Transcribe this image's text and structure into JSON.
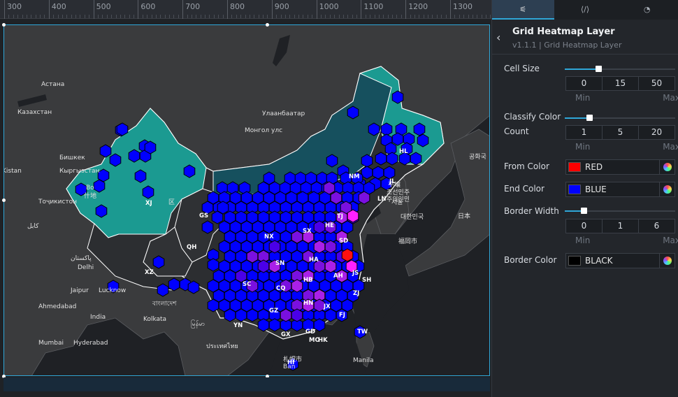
{
  "ruler": {
    "ticks": [
      "300",
      "400",
      "500",
      "600",
      "700",
      "800",
      "900",
      "1000",
      "1100",
      "1200",
      "1300"
    ]
  },
  "map": {
    "countries": [
      "Астана",
      "Казахстан",
      "Бишкек",
      "Кыргызстан",
      "Тоҷикистон",
      "Kistan",
      "کابل",
      "پاکستان",
      "Delhi",
      "Jaipur",
      "Lucknow",
      "Ahmedabad",
      "India",
      "Kolkata",
      "Mumbai",
      "Hyderabad",
      "Улаанбаатар",
      "Монгол улс",
      "বাংলাদেশ",
      "မြန်မာ",
      "ประเทศไทย",
      "Manila",
      "日本",
      "서울",
      "대한민국",
      "福岡市",
      "平壤",
      "조선민주",
      "주의인민",
      "공화국",
      "札幌市",
      "Ban",
      "Bo",
      "什地",
      "区",
      "Ha"
    ],
    "provinces": [
      "XJ",
      "XZ",
      "QH",
      "GS",
      "NM",
      "HL",
      "JL",
      "LN",
      "NX",
      "SX",
      "HE",
      "TJ",
      "SD",
      "SN",
      "HA",
      "AH",
      "JS",
      "SH",
      "SC",
      "CQ",
      "HB",
      "ZJ",
      "HN",
      "JX",
      "FJ",
      "GZ",
      "YN",
      "GX",
      "GD",
      "MO",
      "HK",
      "TW",
      "HI"
    ]
  },
  "panel": {
    "tabs": [
      "⚟",
      "⟨/⟩",
      "◔"
    ],
    "back_icon": "‹",
    "title": "Grid Heatmap Layer",
    "subtitle": "v1.1.1 | Grid Heatmap Layer",
    "cell_size": {
      "label": "Cell Size",
      "value": "15",
      "min": "0",
      "max": "50",
      "min_label": "Min",
      "max_label": "Max"
    },
    "classify": {
      "label1": "Classify Color",
      "label2": "Count",
      "value": "5",
      "min": "1",
      "max": "20",
      "min_label": "Min",
      "max_label": "Max"
    },
    "from_color": {
      "label": "From Color",
      "name": "RED",
      "hex": "#ff0000"
    },
    "end_color": {
      "label": "End Color",
      "name": "BLUE",
      "hex": "#0000ff"
    },
    "border_width": {
      "label": "Border Width",
      "value": "1",
      "min": "0",
      "max": "6",
      "min_label": "Min",
      "max_label": "Max"
    },
    "border_color": {
      "label": "Border Color",
      "name": "BLACK",
      "hex": "#000000"
    }
  },
  "colors": {
    "accent": "#2fa7d8",
    "teal_region": "#1b9a91",
    "dark_teal_region": "#16505e",
    "land": "#3b3b3b",
    "water": "#1c1e22"
  }
}
